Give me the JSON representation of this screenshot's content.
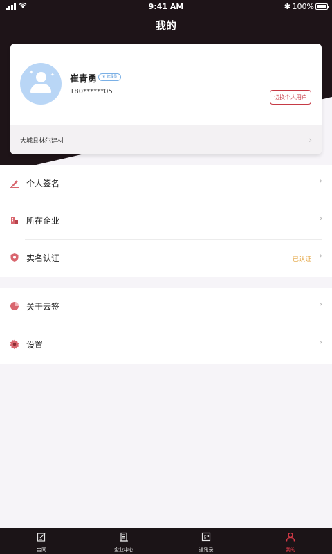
{
  "status_bar": {
    "time": "9:41 AM",
    "battery": "100%"
  },
  "nav": {
    "title": "我的"
  },
  "profile": {
    "name": "崔青勇",
    "role_badge": "★ 管理员",
    "phone": "180******05",
    "switch_button": "切换个人用户",
    "company": "大城县林尔建材"
  },
  "menu_group_1": [
    {
      "label": "个人签名",
      "icon": "pen-icon"
    },
    {
      "label": "所在企业",
      "icon": "building-icon"
    },
    {
      "label": "实名认证",
      "icon": "shield-icon",
      "status": "已认证"
    }
  ],
  "menu_group_2": [
    {
      "label": "关于云签",
      "icon": "circle-logo-icon"
    },
    {
      "label": "设置",
      "icon": "gear-icon"
    }
  ],
  "tabbar": [
    {
      "label": "合同",
      "icon": "contract-icon"
    },
    {
      "label": "企业中心",
      "icon": "building-icon"
    },
    {
      "label": "通讯录",
      "icon": "contacts-icon"
    },
    {
      "label": "我的",
      "icon": "person-icon",
      "active": true
    }
  ],
  "colors": {
    "accent": "#d93a48",
    "dark_bg": "#1e1418",
    "verified": "#e3a23b",
    "badge": "#4a8fd6"
  }
}
